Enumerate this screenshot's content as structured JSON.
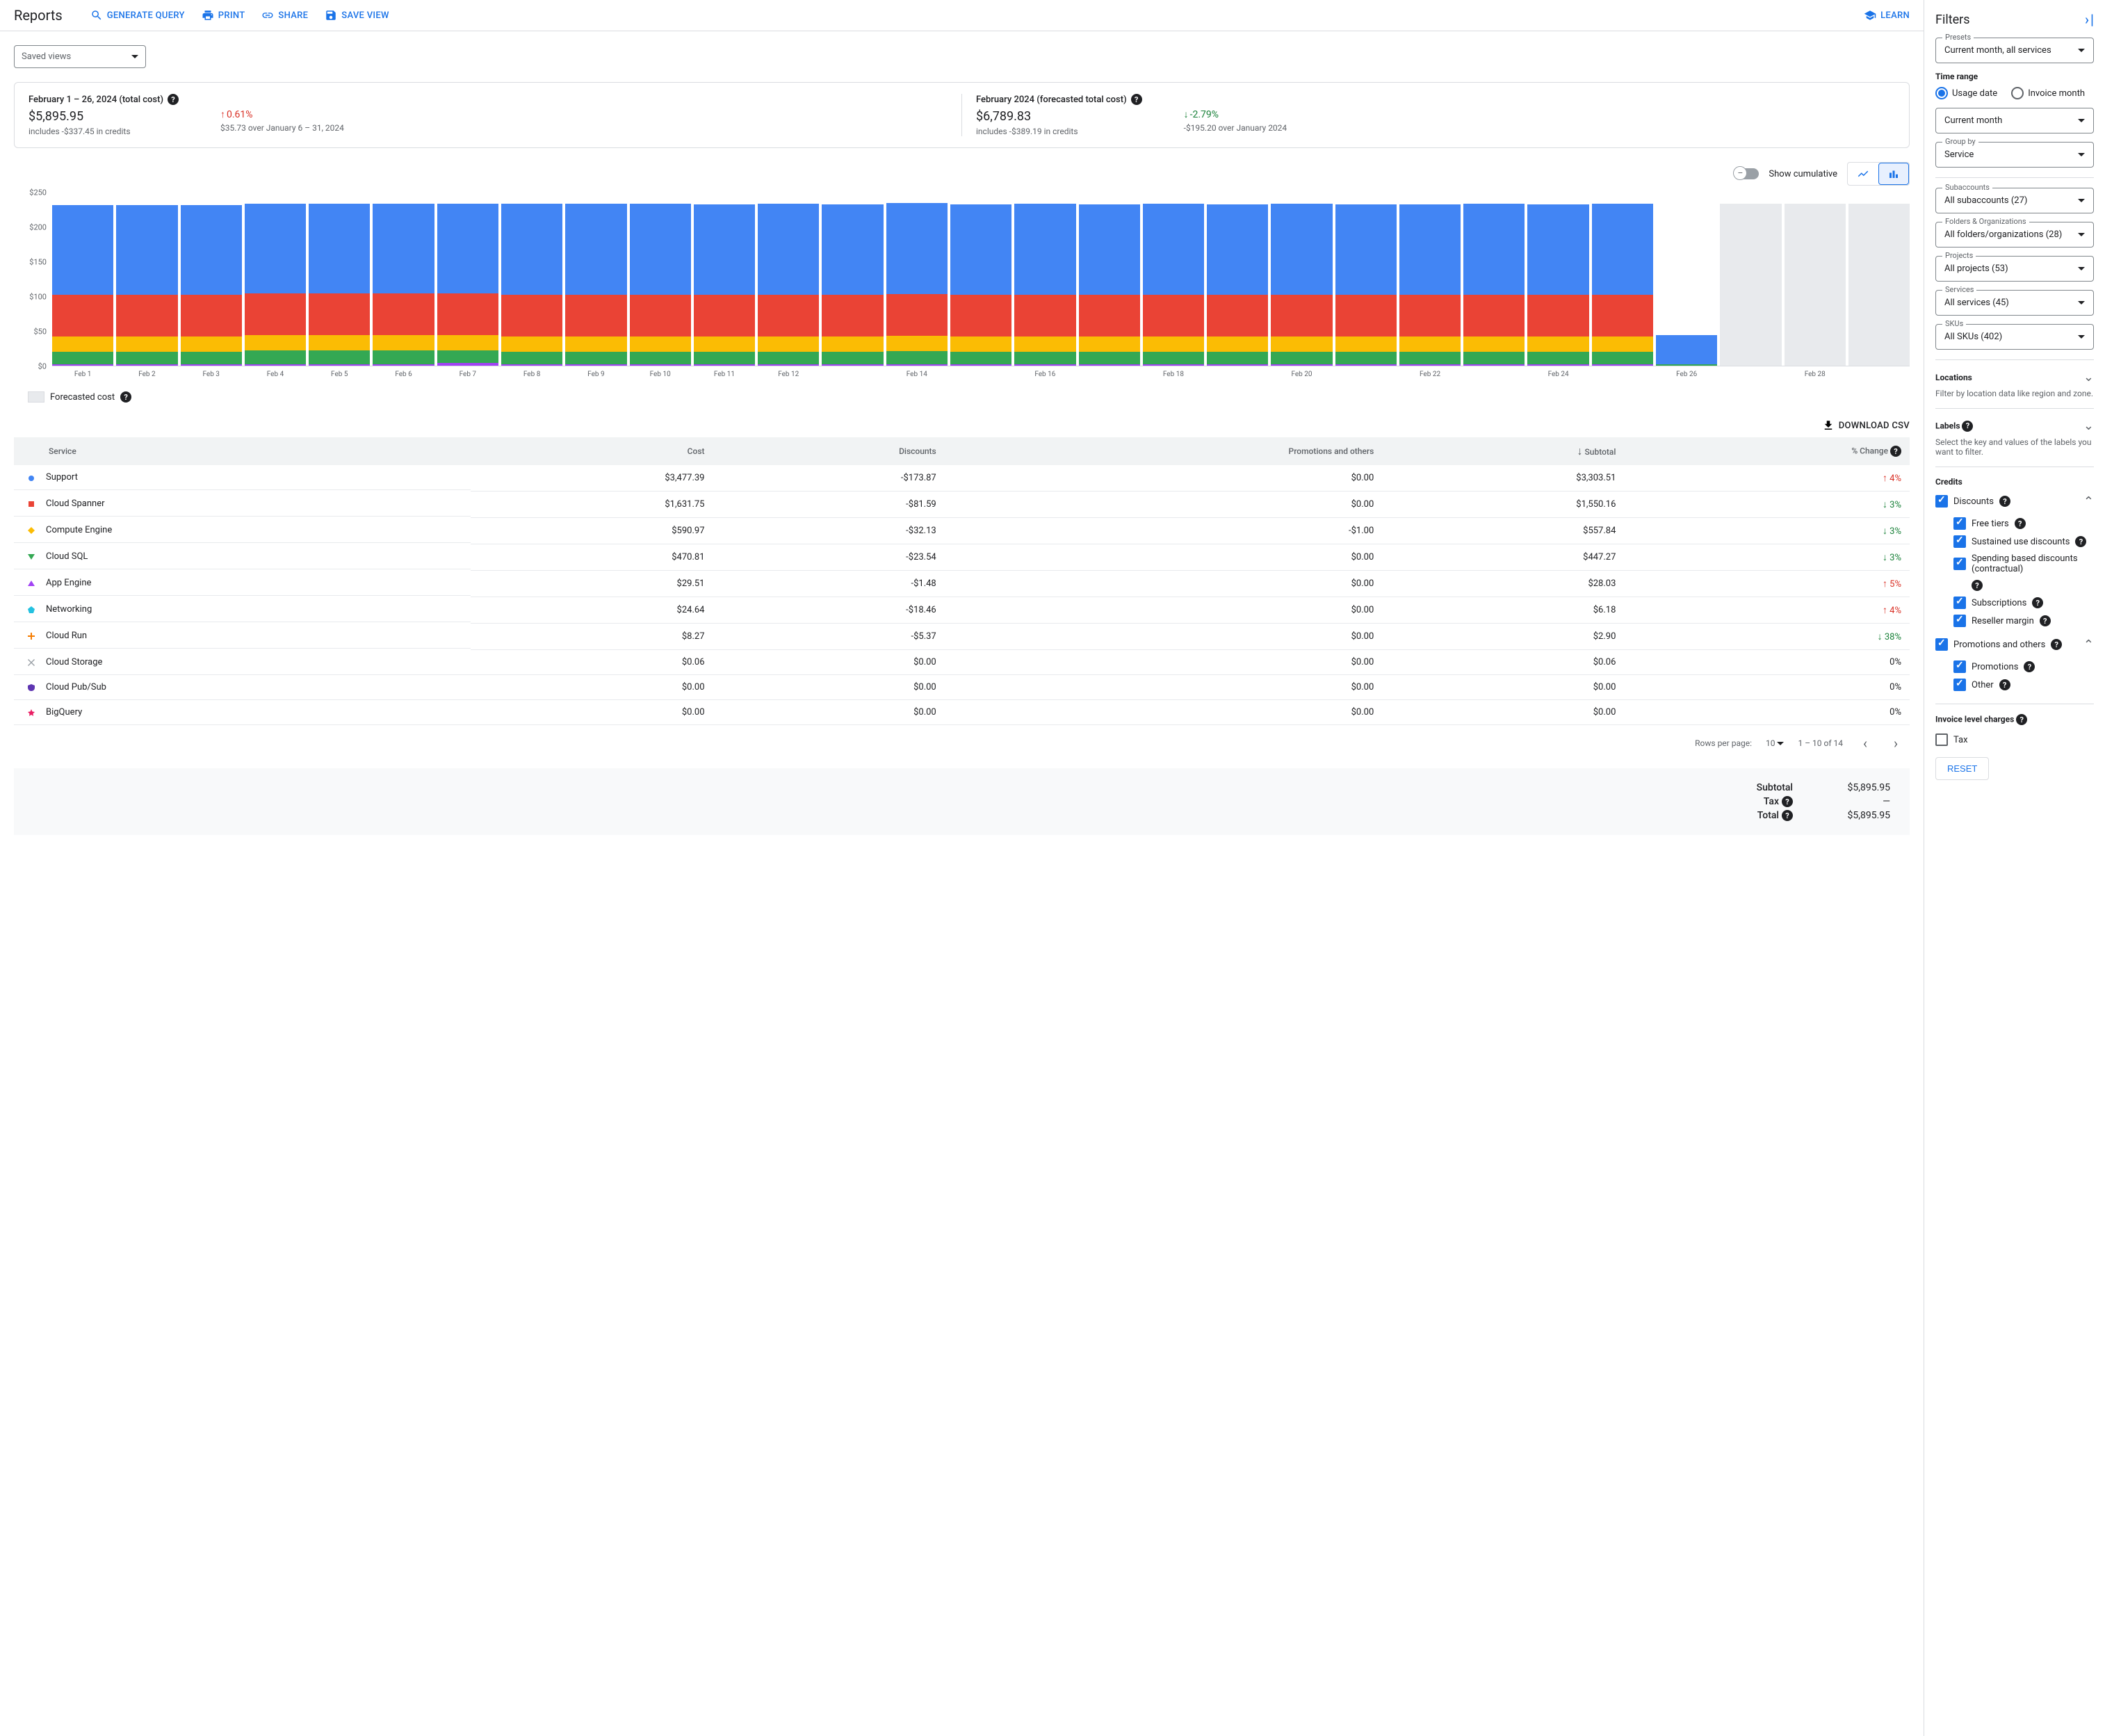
{
  "header": {
    "title": "Reports",
    "generate_query": "GENERATE QUERY",
    "print": "PRINT",
    "share": "SHARE",
    "save_view": "SAVE VIEW",
    "learn": "LEARN"
  },
  "saved_views": {
    "label": "Saved views"
  },
  "summary": {
    "card1": {
      "title": "February 1 – 26, 2024 (total cost)",
      "value": "$5,895.95",
      "sub": "includes -$337.45 in credits",
      "change": "0.61%",
      "change_dir": "up",
      "change_sub": "$35.73 over January 6 – 31, 2024"
    },
    "card2": {
      "title": "February 2024 (forecasted total cost)",
      "value": "$6,789.83",
      "sub": "includes -$389.19 in credits",
      "change": "-2.79%",
      "change_dir": "down",
      "change_sub": "-$195.20 over January 2024"
    }
  },
  "chart_controls": {
    "cumulative": "Show cumulative"
  },
  "chart_data": {
    "type": "bar",
    "ylim": [
      0,
      250
    ],
    "yticks": [
      "$0",
      "$50",
      "$100",
      "$150",
      "$200",
      "$250"
    ],
    "categories": [
      "Feb 1",
      "Feb 2",
      "Feb 3",
      "Feb 4",
      "Feb 5",
      "Feb 6",
      "Feb 7",
      "Feb 8",
      "Feb 9",
      "Feb 10",
      "Feb 11",
      "Feb 12",
      "",
      "Feb 14",
      "",
      "Feb 16",
      "",
      "Feb 18",
      "",
      "Feb 20",
      "",
      "Feb 22",
      "",
      "Feb 24",
      "",
      "Feb 26",
      "",
      "Feb 28",
      ""
    ],
    "series_colors": {
      "support": "#4285f4",
      "spanner": "#ea4335",
      "compute": "#fbbc04",
      "sql": "#34a853",
      "other": "#a142f4",
      "forecast": "#e8eaed"
    },
    "days": [
      {
        "support": 130,
        "spanner": 60,
        "compute": 22,
        "sql": 18,
        "other": 2
      },
      {
        "support": 130,
        "spanner": 60,
        "compute": 22,
        "sql": 18,
        "other": 2
      },
      {
        "support": 130,
        "spanner": 60,
        "compute": 22,
        "sql": 18,
        "other": 2
      },
      {
        "support": 130,
        "spanner": 60,
        "compute": 22,
        "sql": 20,
        "other": 2
      },
      {
        "support": 130,
        "spanner": 60,
        "compute": 22,
        "sql": 20,
        "other": 2
      },
      {
        "support": 130,
        "spanner": 60,
        "compute": 22,
        "sql": 20,
        "other": 2
      },
      {
        "support": 130,
        "spanner": 60,
        "compute": 22,
        "sql": 18,
        "other": 4
      },
      {
        "support": 132,
        "spanner": 60,
        "compute": 22,
        "sql": 18,
        "other": 2
      },
      {
        "support": 132,
        "spanner": 60,
        "compute": 22,
        "sql": 18,
        "other": 2
      },
      {
        "support": 132,
        "spanner": 60,
        "compute": 22,
        "sql": 18,
        "other": 2
      },
      {
        "support": 131,
        "spanner": 60,
        "compute": 22,
        "sql": 18,
        "other": 2
      },
      {
        "support": 132,
        "spanner": 60,
        "compute": 22,
        "sql": 18,
        "other": 2
      },
      {
        "support": 131,
        "spanner": 60,
        "compute": 22,
        "sql": 18,
        "other": 2
      },
      {
        "support": 132,
        "spanner": 60,
        "compute": 22,
        "sql": 19,
        "other": 2
      },
      {
        "support": 131,
        "spanner": 60,
        "compute": 22,
        "sql": 18,
        "other": 2
      },
      {
        "support": 132,
        "spanner": 60,
        "compute": 22,
        "sql": 18,
        "other": 2
      },
      {
        "support": 131,
        "spanner": 60,
        "compute": 22,
        "sql": 18,
        "other": 2
      },
      {
        "support": 132,
        "spanner": 60,
        "compute": 22,
        "sql": 18,
        "other": 2
      },
      {
        "support": 131,
        "spanner": 60,
        "compute": 22,
        "sql": 18,
        "other": 2
      },
      {
        "support": 132,
        "spanner": 60,
        "compute": 22,
        "sql": 18,
        "other": 2
      },
      {
        "support": 131,
        "spanner": 60,
        "compute": 22,
        "sql": 18,
        "other": 2
      },
      {
        "support": 131,
        "spanner": 60,
        "compute": 22,
        "sql": 18,
        "other": 2
      },
      {
        "support": 132,
        "spanner": 60,
        "compute": 22,
        "sql": 18,
        "other": 2
      },
      {
        "support": 131,
        "spanner": 60,
        "compute": 22,
        "sql": 18,
        "other": 2
      },
      {
        "support": 132,
        "spanner": 60,
        "compute": 22,
        "sql": 18,
        "other": 2
      },
      {
        "support": 42,
        "spanner": 0,
        "compute": 0,
        "sql": 2,
        "other": 0
      },
      {
        "forecast": 234
      },
      {
        "forecast": 234
      },
      {
        "forecast": 234
      }
    ],
    "legend_forecast": "Forecasted cost"
  },
  "download_csv": "DOWNLOAD CSV",
  "table": {
    "headers": {
      "service": "Service",
      "cost": "Cost",
      "discounts": "Discounts",
      "promotions": "Promotions and others",
      "subtotal": "Subtotal",
      "change": "% Change"
    },
    "rows": [
      {
        "marker": "#4285f4",
        "shape": "circle",
        "service": "Support",
        "cost": "$3,477.39",
        "discounts": "-$173.87",
        "promotions": "$0.00",
        "subtotal": "$3,303.51",
        "change": "4%",
        "dir": "up"
      },
      {
        "marker": "#ea4335",
        "shape": "square",
        "service": "Cloud Spanner",
        "cost": "$1,631.75",
        "discounts": "-$81.59",
        "promotions": "$0.00",
        "subtotal": "$1,550.16",
        "change": "3%",
        "dir": "down"
      },
      {
        "marker": "#fbbc04",
        "shape": "diamond",
        "service": "Compute Engine",
        "cost": "$590.97",
        "discounts": "-$32.13",
        "promotions": "-$1.00",
        "subtotal": "$557.84",
        "change": "3%",
        "dir": "down"
      },
      {
        "marker": "#34a853",
        "shape": "triangle-down",
        "service": "Cloud SQL",
        "cost": "$470.81",
        "discounts": "-$23.54",
        "promotions": "$0.00",
        "subtotal": "$447.27",
        "change": "3%",
        "dir": "down"
      },
      {
        "marker": "#a142f4",
        "shape": "triangle-up",
        "service": "App Engine",
        "cost": "$29.51",
        "discounts": "-$1.48",
        "promotions": "$0.00",
        "subtotal": "$28.03",
        "change": "5%",
        "dir": "up"
      },
      {
        "marker": "#24c1e0",
        "shape": "pentagon",
        "service": "Networking",
        "cost": "$24.64",
        "discounts": "-$18.46",
        "promotions": "$0.00",
        "subtotal": "$6.18",
        "change": "4%",
        "dir": "up"
      },
      {
        "marker": "#f57c00",
        "shape": "plus",
        "service": "Cloud Run",
        "cost": "$8.27",
        "discounts": "-$5.37",
        "promotions": "$0.00",
        "subtotal": "$2.90",
        "change": "38%",
        "dir": "down"
      },
      {
        "marker": "#9aa0a6",
        "shape": "cross",
        "service": "Cloud Storage",
        "cost": "$0.06",
        "discounts": "$0.00",
        "promotions": "$0.00",
        "subtotal": "$0.06",
        "change": "0%",
        "dir": "none"
      },
      {
        "marker": "#5e35b1",
        "shape": "shield",
        "service": "Cloud Pub/Sub",
        "cost": "$0.00",
        "discounts": "$0.00",
        "promotions": "$0.00",
        "subtotal": "$0.00",
        "change": "0%",
        "dir": "none"
      },
      {
        "marker": "#e91e63",
        "shape": "star",
        "service": "BigQuery",
        "cost": "$0.00",
        "discounts": "$0.00",
        "promotions": "$0.00",
        "subtotal": "$0.00",
        "change": "0%",
        "dir": "none"
      }
    ]
  },
  "pager": {
    "rows_per_page_label": "Rows per page:",
    "rows_per_page": "10",
    "range": "1 – 10 of 14"
  },
  "totals": {
    "subtotal_label": "Subtotal",
    "subtotal": "$5,895.95",
    "tax_label": "Tax",
    "tax": "—",
    "total_label": "Total",
    "total": "$5,895.95"
  },
  "filters": {
    "title": "Filters",
    "presets": {
      "label": "Presets",
      "value": "Current month, all services"
    },
    "time_range_label": "Time range",
    "time_radios": {
      "usage": "Usage date",
      "invoice": "Invoice month"
    },
    "time_value": "Current month",
    "group_by": {
      "label": "Group by",
      "value": "Service"
    },
    "subaccounts": {
      "label": "Subaccounts",
      "value": "All subaccounts (27)"
    },
    "folders": {
      "label": "Folders & Organizations",
      "value": "All folders/organizations (28)"
    },
    "projects": {
      "label": "Projects",
      "value": "All projects (53)"
    },
    "services": {
      "label": "Services",
      "value": "All services (45)"
    },
    "skus": {
      "label": "SKUs",
      "value": "All SKUs (402)"
    },
    "locations": {
      "label": "Locations",
      "hint": "Filter by location data like region and zone."
    },
    "labels": {
      "label": "Labels",
      "hint": "Select the key and values of the labels you want to filter."
    },
    "credits": {
      "label": "Credits",
      "discounts": "Discounts",
      "free_tiers": "Free tiers",
      "sustained": "Sustained use discounts",
      "spending": "Spending based discounts (contractual)",
      "subscriptions": "Subscriptions",
      "reseller": "Reseller margin",
      "promotions_group": "Promotions and others",
      "promotions": "Promotions",
      "other": "Other"
    },
    "invoice_level": {
      "label": "Invoice level charges",
      "tax": "Tax"
    },
    "reset": "RESET"
  }
}
